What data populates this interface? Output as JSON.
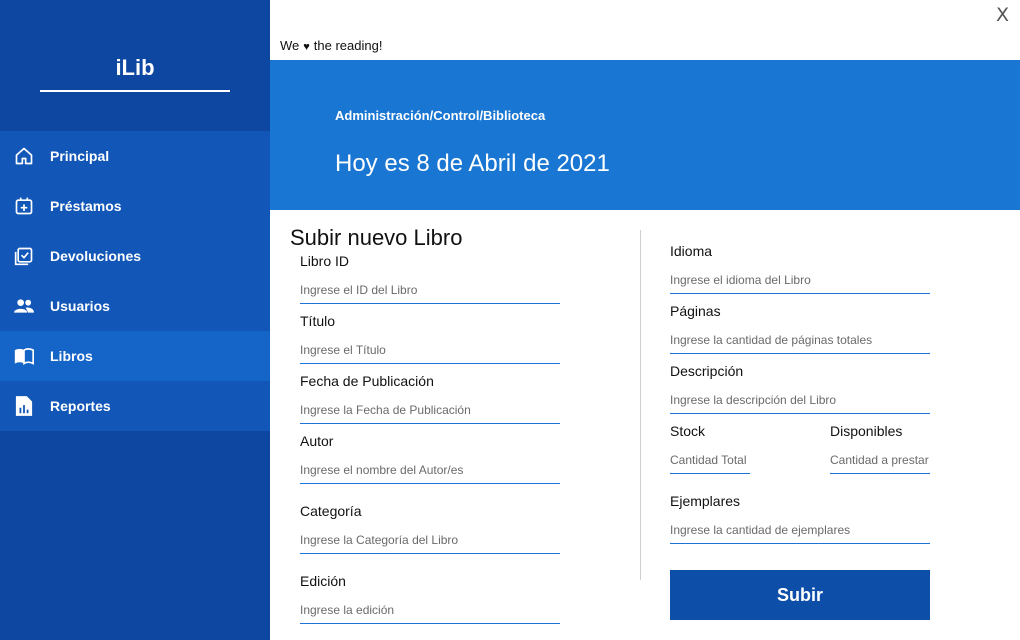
{
  "app": {
    "brand": "iLib",
    "close_label": "X",
    "tagline_before": "We",
    "tagline_heart": "♥",
    "tagline_after": "the reading!"
  },
  "sidebar": {
    "items": [
      {
        "label": "Principal",
        "icon": "home-icon"
      },
      {
        "label": "Préstamos",
        "icon": "calendar-plus-icon"
      },
      {
        "label": "Devoluciones",
        "icon": "calendar-check-icon"
      },
      {
        "label": "Usuarios",
        "icon": "users-icon"
      },
      {
        "label": "Libros",
        "icon": "book-icon",
        "active": true
      },
      {
        "label": "Reportes",
        "icon": "report-icon"
      }
    ]
  },
  "banner": {
    "breadcrumb": "Administración/Control/Biblioteca",
    "date": "Hoy es 8 de Abril de 2021"
  },
  "form": {
    "title": "Subir nuevo Libro",
    "left": [
      {
        "label": "Libro ID",
        "placeholder": "Ingrese el ID del Libro"
      },
      {
        "label": "Título",
        "placeholder": "Ingrese el Título"
      },
      {
        "label": "Fecha de Publicación",
        "placeholder": "Ingrese la Fecha de Publicación"
      },
      {
        "label": "Autor",
        "placeholder": "Ingrese el nombre del Autor/es"
      },
      {
        "label": "Categoría",
        "placeholder": "Ingrese la Categoría del Libro"
      },
      {
        "label": "Edición",
        "placeholder": "Ingrese la edición"
      }
    ],
    "right": [
      {
        "label": "Idioma",
        "placeholder": "Ingrese el idioma del Libro"
      },
      {
        "label": "Páginas",
        "placeholder": "Ingrese la cantidad de páginas totales"
      },
      {
        "label": "Descripción",
        "placeholder": "Ingrese la descripción del Libro"
      },
      {
        "label": "Stock",
        "placeholder": "Cantidad Total"
      },
      {
        "label": "Disponibles",
        "placeholder": "Cantidad a prestar"
      },
      {
        "label": "Ejemplares",
        "placeholder": "Ingrese la cantidad de ejemplares"
      }
    ],
    "submit_label": "Subir"
  },
  "colors": {
    "sidebar": "#0d47a1",
    "nav_item": "#1257b8",
    "nav_active": "#1565c8",
    "banner": "#1976d2",
    "accent_line": "#1e73d6",
    "button": "#0d4fa8"
  }
}
